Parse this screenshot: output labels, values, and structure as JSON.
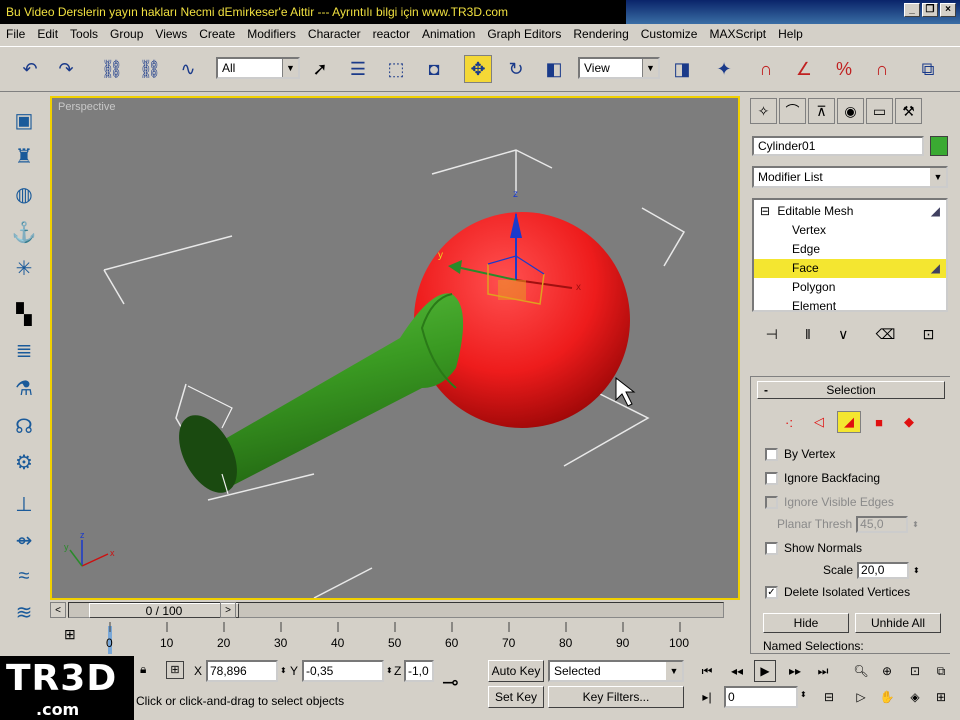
{
  "title_banner": "Bu Video Derslerin yayın hakları Necmi dEmirkeser'e Aittir --- Ayrıntılı bilgi için www.TR3D.com",
  "window_buttons": [
    "_",
    "❐",
    "×"
  ],
  "menu": [
    "File",
    "Edit",
    "Tools",
    "Group",
    "Views",
    "Create",
    "Modifiers",
    "Character",
    "reactor",
    "Animation",
    "Graph Editors",
    "Rendering",
    "Customize",
    "MAXScript",
    "Help"
  ],
  "toolbar": {
    "filter_value": "All",
    "refcoord_value": "View"
  },
  "viewport": {
    "label": "Perspective",
    "gizmo_axes": {
      "x": "x",
      "y": "y",
      "z": "z"
    },
    "tripod_axes": {
      "x": "x",
      "y": "y",
      "z": "z"
    }
  },
  "timeslider": {
    "frame_label": "0 / 100",
    "prev": "<",
    "next": ">"
  },
  "trackbar": {
    "ticks": [
      "0",
      "10",
      "20",
      "30",
      "40",
      "50",
      "60",
      "70",
      "80",
      "90",
      "100"
    ]
  },
  "command_panel": {
    "object_name": "Cylinder01",
    "object_color": "#3aaa32",
    "modifier_list": "Modifier List",
    "stack": {
      "root": "Editable Mesh",
      "items": [
        "Vertex",
        "Edge",
        "Face",
        "Polygon",
        "Element"
      ],
      "selected": "Face"
    },
    "selection": {
      "title": "Selection",
      "by_vertex": "By Vertex",
      "ignore_backfacing": "Ignore Backfacing",
      "ignore_visible_edges": "Ignore Visible Edges",
      "planar_thresh_label": "Planar Thresh",
      "planar_thresh_value": "45,0",
      "show_normals": "Show Normals",
      "scale_label": "Scale",
      "scale_value": "20,0",
      "delete_isolated": "Delete Isolated Vertices",
      "hide": "Hide",
      "unhide_all": "Unhide All",
      "named_selections": "Named Selections:"
    }
  },
  "status": {
    "logo_main": "TR3D",
    "logo_sub": ".com",
    "x_label": "X",
    "x_value": "78,896",
    "y_label": "Y",
    "y_value": "-0,35",
    "z_label": "Z",
    "z_value": "-1,0",
    "prompt": "Click or click-and-drag to select objects",
    "auto_key": "Auto Key",
    "set_key": "Set Key",
    "key_mode": "Selected",
    "key_filters": "Key Filters...",
    "current_frame": "0"
  },
  "colors": {
    "sphere": "#ee1c1c",
    "cylinder": "#3a9a22",
    "viewport_bg": "#7d7d7d",
    "active_highlight": "#f4e630"
  }
}
